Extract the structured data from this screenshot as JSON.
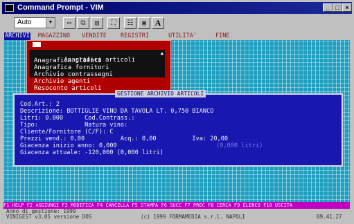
{
  "window": {
    "title": "Command Prompt - VIM",
    "min": "_",
    "max": "□",
    "close": "×"
  },
  "toolbar": {
    "font_size": "Auto",
    "letter_button": "A"
  },
  "menubar": [
    "ARCHIVI",
    "MAGAZZINO",
    "VENDITE",
    "REGISTRI",
    "UTILITA'",
    "FINE"
  ],
  "dropdown": {
    "items": [
      "Anagrafica articoli",
      "Anagrafica clienti",
      "Anagrafica fornitori",
      "Archivio contrassegni",
      "Archivio agenti",
      "Resoconto articoli"
    ],
    "selected_index": 0
  },
  "panel": {
    "title": "GESTIONE ARCHIVIO ARTICOLI",
    "lines": [
      "Cod.Art.: 2",
      "Descrizione: BOTTIGLIE VINO DA TAVOLA LT. 0,750 BIANCO",
      "Litri: 0.000      Cod.Contrass.:",
      "Tipo:             Natura vino:",
      "Cliente/Fornitore (C/F): C",
      "Prezzi vend.: 0,00          Acq.: 0,00          Iva: 20,00",
      "Giacenza inizio anno: 0,000                 ",
      "Giacenza attuale: -120,000 (0,000 litri)"
    ],
    "dim_text": "(0,000 litri)"
  },
  "fkeys": "F1 HELP F2 AGGIUNGI F3 MODIFICA F4 CANCELLA F5 STAMPA F6 SUCC F7 PREC F8 CERCA F9 ELENCO F10 USCITA",
  "status": {
    "year": "Anno di gestione: 1999",
    "version": "VINIGEST v3.05 versione DOS",
    "copyright": "(c) 1999 FORMAMEDIA s.r.l. NAPOLI",
    "time": "09.41.27"
  }
}
